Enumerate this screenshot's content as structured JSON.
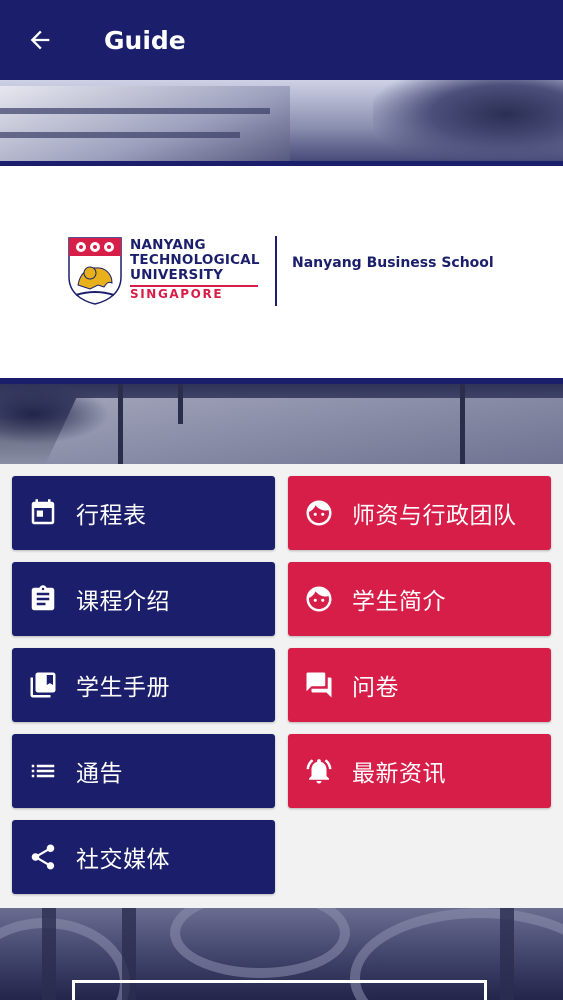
{
  "appbar": {
    "title": "Guide",
    "back_icon": "arrow-left-icon"
  },
  "logo": {
    "name_lines": [
      "NANYANG",
      "TECHNOLOGICAL",
      "UNIVERSITY"
    ],
    "country": "SINGAPORE",
    "school": "Nanyang Business School"
  },
  "colors": {
    "navy": "#1b1f6b",
    "red": "#d71e49",
    "white": "#ffffff"
  },
  "menu": {
    "left": [
      {
        "label": "行程表",
        "icon": "calendar-icon"
      },
      {
        "label": "课程介绍",
        "icon": "clipboard-icon"
      },
      {
        "label": "学生手册",
        "icon": "book-library-icon"
      },
      {
        "label": "通告",
        "icon": "list-icon"
      },
      {
        "label": "社交媒体",
        "icon": "share-icon"
      }
    ],
    "right": [
      {
        "label": "师资与行政团队",
        "icon": "face-icon"
      },
      {
        "label": "学生简介",
        "icon": "face-icon"
      },
      {
        "label": "问卷",
        "icon": "chat-bubbles-icon"
      },
      {
        "label": "最新资讯",
        "icon": "bell-ringing-icon"
      }
    ]
  }
}
